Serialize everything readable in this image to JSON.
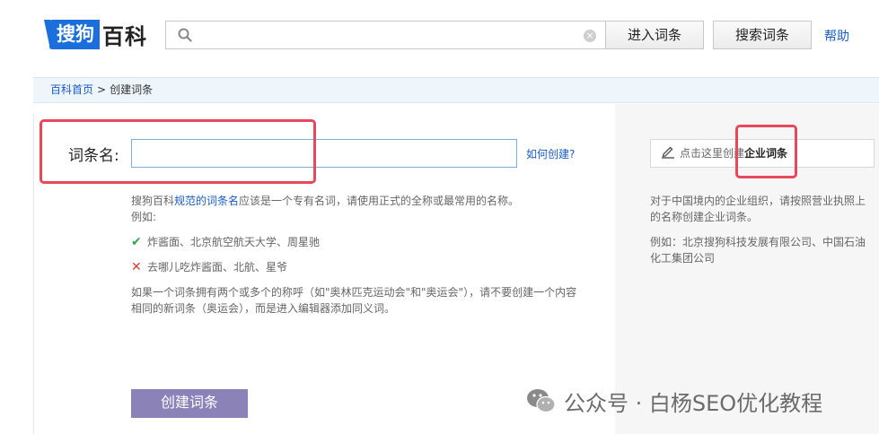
{
  "header": {
    "logo_badge": "搜狗",
    "logo_text": "百科",
    "search_placeholder": "",
    "enter_label": "进入词条",
    "search_label": "搜索词条",
    "help_label": "帮助"
  },
  "breadcrumb": {
    "home": "百科首页",
    "sep": ">",
    "current": "创建词条"
  },
  "form": {
    "name_label": "词条名:",
    "name_value": "",
    "how_link": "如何创建?",
    "hint_prefix": "搜狗百科",
    "hint_link": "规范的词条名",
    "hint_suffix": "应该是一个专有名词，请使用正式的全称或最常用的名称。",
    "example_label": "例如:",
    "good_example": "炸酱面、北京航空航天大学、周星驰",
    "bad_example": "去哪儿吃炸酱面、北航、星爷",
    "note_line1": "如果一个词条拥有两个或多个的称呼（如\"奥林匹克运动会\"和\"奥运会\"），请不要创建一个内容",
    "note_line2": "相同的新词条（奥运会），而是进入编辑器添加同义词。",
    "create_button": "创建词条"
  },
  "enterprise": {
    "button_prefix": "点击这里创建",
    "button_strong": "企业词条",
    "desc_line1": "对于中国境内的企业组织，请按照营业执照上",
    "desc_line2": "的名称创建企业词条。",
    "example_line1": "例如：北京搜狗科技发展有限公司、中国石油",
    "example_line2": "化工集团公司"
  },
  "watermark": {
    "text": "公众号 · 白杨SEO优化教程"
  },
  "colors": {
    "brand_blue": "#1b6fdc",
    "link_blue": "#1a5cc8",
    "annotation_red": "#e8475c",
    "create_button": "#8b82b8"
  }
}
